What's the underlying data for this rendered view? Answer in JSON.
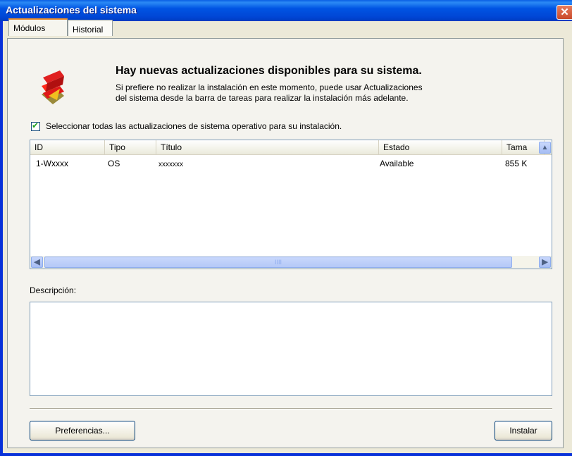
{
  "window": {
    "title": "Actualizaciones del sistema",
    "close_glyph": "✕"
  },
  "tabs": [
    {
      "label": "Módulos",
      "active": true
    },
    {
      "label": "Historial",
      "active": false
    }
  ],
  "header": {
    "icon": "system-update-logo-icon",
    "headline": "Hay nuevas actualizaciones disponibles para su sistema.",
    "description_line1": "Si prefiere no realizar la instalación en este momento, puede usar Actualizaciones",
    "description_line2": "del sistema desde la barra de tareas para realizar la instalación más adelante."
  },
  "select_all": {
    "checked": true,
    "label": "Seleccionar todas las actualizaciones de sistema operativo para su instalación."
  },
  "updates_table": {
    "columns": [
      "ID",
      "Tipo",
      "Título",
      "Estado",
      "Tama"
    ],
    "rows": [
      {
        "id": "1-Wxxxx",
        "tipo": "OS",
        "titulo": "xxxxxxx",
        "estado": "Available",
        "tamano": "855 K"
      }
    ],
    "scroll_up_glyph": "▲",
    "scroll_left_glyph": "◀",
    "scroll_right_glyph": "▶",
    "thumb_grip": "IIII"
  },
  "description": {
    "label": "Descripción:",
    "value": ""
  },
  "buttons": {
    "preferences": "Preferencias...",
    "install": "Instalar"
  },
  "colors": {
    "titlebar": "#0054e3",
    "close_button": "#c94a2b",
    "dialog_background": "#ece9d8"
  }
}
